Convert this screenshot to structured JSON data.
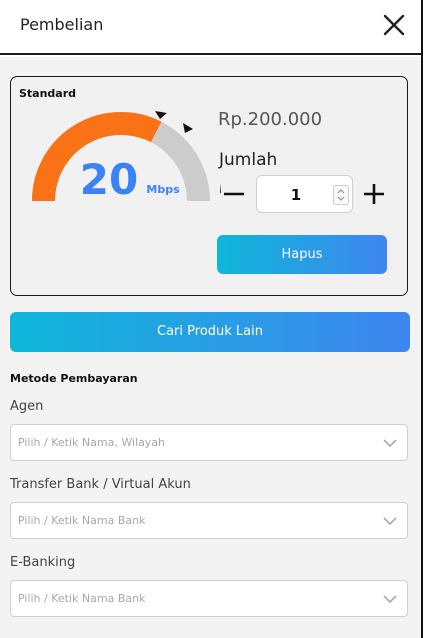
{
  "header": {
    "title": "Pembelian"
  },
  "product": {
    "name": "Standard",
    "speed_value": "20",
    "speed_unit": "Mbps",
    "gauge_level_percent": 65,
    "price": "Rp.200.000",
    "quantity_label": "Jumlah",
    "quantity": "1",
    "remove_label": "Hapus"
  },
  "actions": {
    "other_products_label": "Cari Produk Lain"
  },
  "payment": {
    "title": "Metode Pembayaran",
    "fields": [
      {
        "label": "Agen",
        "placeholder": "Pilih / Ketik Nama, Wilayah"
      },
      {
        "label": "Transfer Bank / Virtual Akun",
        "placeholder": "Pilih / Ketik Nama Bank"
      },
      {
        "label": "E-Banking",
        "placeholder": "Pilih / Ketik Nama Bank"
      }
    ]
  },
  "colors": {
    "accent_start": "#0fb6d9",
    "accent_end": "#3f86f0",
    "gauge_fill": "#f97316",
    "gauge_track": "#cccccc",
    "speed_text": "#3b82f6"
  }
}
